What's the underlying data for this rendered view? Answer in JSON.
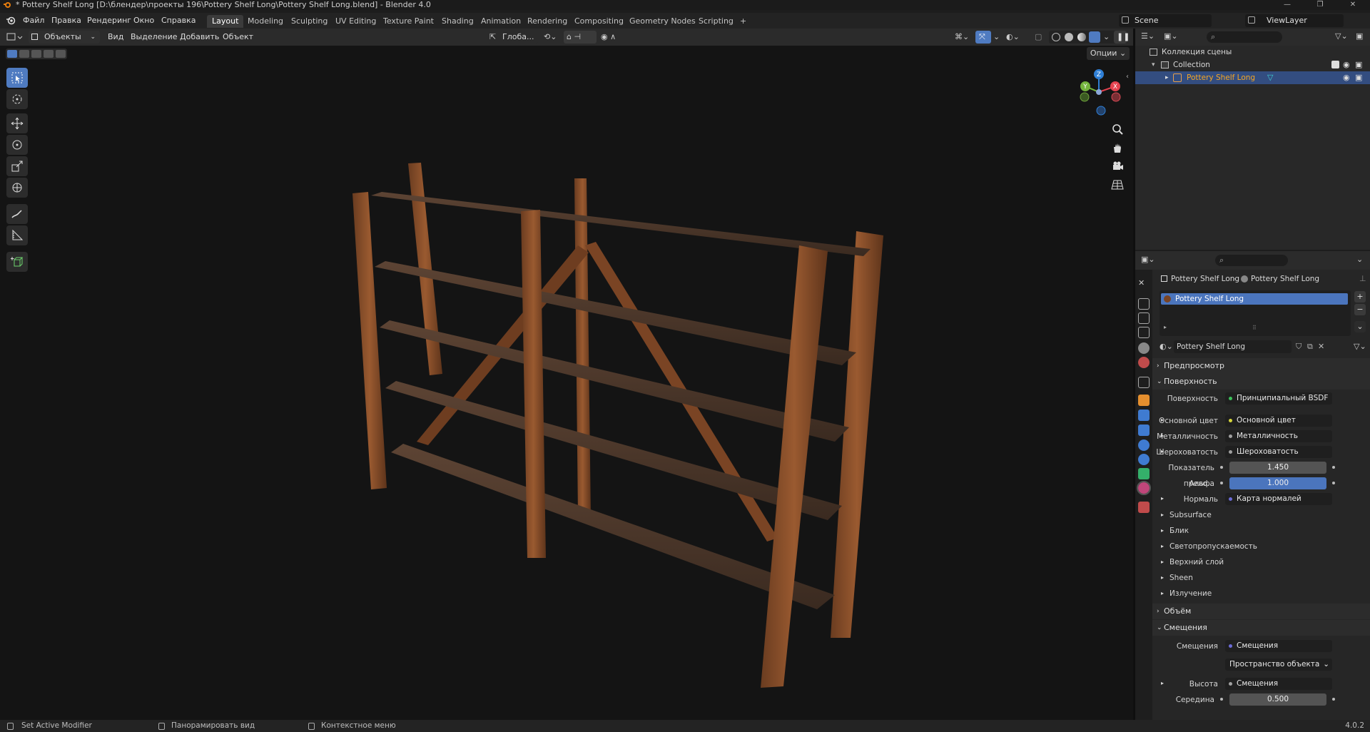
{
  "window": {
    "title": "* Pottery Shelf Long [D:\\блендер\\проекты 196\\Pottery Shelf Long\\Pottery Shelf Long.blend] - Blender 4.0"
  },
  "menubar": {
    "items": [
      "Файл",
      "Правка",
      "Рендеринг",
      "Окно",
      "Справка"
    ],
    "workspaces": [
      "Layout",
      "Modeling",
      "Sculpting",
      "UV Editing",
      "Texture Paint",
      "Shading",
      "Animation",
      "Rendering",
      "Compositing",
      "Geometry Nodes",
      "Scripting"
    ],
    "add_tab": "+",
    "scene": "Scene",
    "view_layer": "ViewLayer"
  },
  "viewport_header": {
    "mode": "Объекты",
    "menus": [
      "Вид",
      "Выделение",
      "Добавить",
      "Объект"
    ],
    "transform_orientation": "Глоба...",
    "options": "Опции"
  },
  "gizmo": {
    "x": "X",
    "y": "Y",
    "z": "Z"
  },
  "outliner": {
    "scene_collection": "Коллекция сцены",
    "collection": "Collection",
    "object": "Pottery Shelf Long"
  },
  "properties": {
    "breadcrumb_object": "Pottery Shelf Long",
    "breadcrumb_material": "Pottery Shelf Long",
    "slot": "Pottery Shelf Long",
    "material_name": "Pottery Shelf Long",
    "sections": {
      "preview": "Предпросмотр",
      "surface": "Поверхность",
      "volume": "Объём",
      "displacement": "Смещения"
    },
    "surface_rows": [
      {
        "label": "Поверхность",
        "value": "Принципиальный BSDF",
        "dot": "#3cc05a"
      },
      {
        "label": "Основной цвет",
        "value": "Основной цвет",
        "dot": "#d6d63b"
      },
      {
        "label": "Металличность",
        "value": "Металличность",
        "dot": "#a0a0a0"
      },
      {
        "label": "Шероховатость",
        "value": "Шероховатость",
        "dot": "#a0a0a0"
      }
    ],
    "ior": {
      "label": "Показатель прело...",
      "value": "1.450"
    },
    "alpha": {
      "label": "Альфа",
      "value": "1.000"
    },
    "normal": {
      "label": "Нормаль",
      "value": "Карта нормалей",
      "dot": "#6b6bd6"
    },
    "subpanels": [
      "Subsurface",
      "Блик",
      "Светопропускаемость",
      "Верхний слой",
      "Sheen",
      "Излучение"
    ],
    "displacement_rows": {
      "disp_label": "Смещения",
      "disp_value": "Смещения",
      "space": "Пространство объекта",
      "height_label": "Высота",
      "height_value": "Смещения",
      "mid_label": "Середина",
      "mid_value": "0.500"
    }
  },
  "statusbar": {
    "left": "Set Active Modifier",
    "middle": "Панорамировать вид",
    "right": "Контекстное меню",
    "version": "4.0.2"
  },
  "colors": {
    "accent": "#4f7bc1",
    "selected_row": "#334d80",
    "object_name": "#f5a623"
  }
}
